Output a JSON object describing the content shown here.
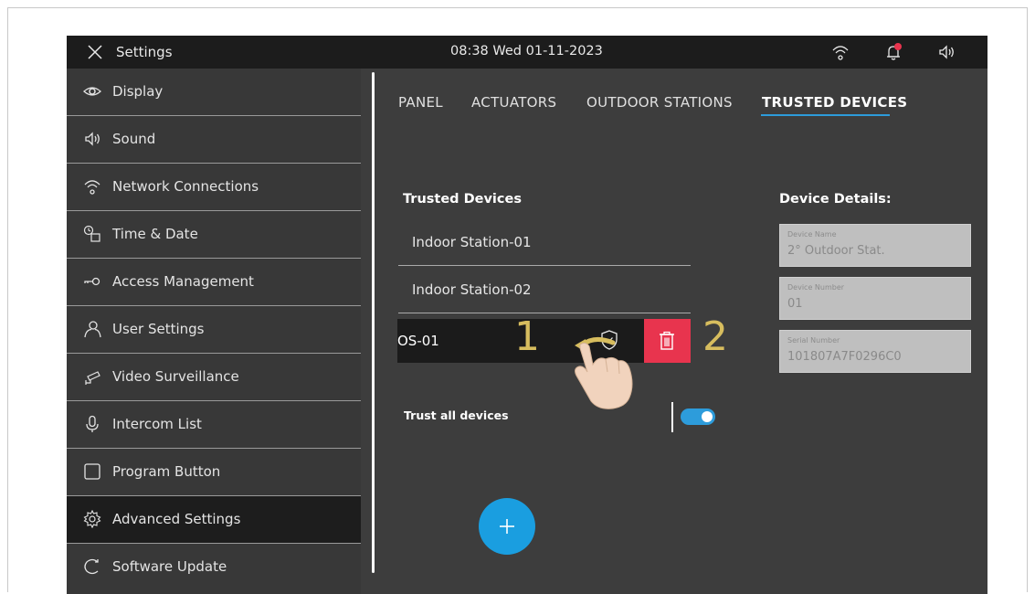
{
  "topbar": {
    "title": "Settings",
    "clock": "08:38  Wed 01-11-2023",
    "icons": [
      "close-icon",
      "wifi-icon",
      "bell-icon",
      "speaker-icon"
    ],
    "notification_dot_color": "#e8344e"
  },
  "sidebar": {
    "items": [
      {
        "label": "Display",
        "icon": "eye-icon"
      },
      {
        "label": "Sound",
        "icon": "speaker-icon"
      },
      {
        "label": "Network Connections",
        "icon": "wifi-icon"
      },
      {
        "label": "Time & Date",
        "icon": "clock-calendar-icon"
      },
      {
        "label": "Access Management",
        "icon": "key-icon"
      },
      {
        "label": "User Settings",
        "icon": "user-icon"
      },
      {
        "label": "Video Surveillance",
        "icon": "camera-icon"
      },
      {
        "label": "Intercom List",
        "icon": "microphone-icon"
      },
      {
        "label": "Program Button",
        "icon": "square-icon"
      },
      {
        "label": "Advanced Settings",
        "icon": "gear-icon",
        "active": true
      },
      {
        "label": "Software Update",
        "icon": "refresh-icon"
      }
    ]
  },
  "tabs": [
    {
      "label": "PANEL"
    },
    {
      "label": "ACTUATORS"
    },
    {
      "label": "OUTDOOR STATIONS"
    },
    {
      "label": "TRUSTED DEVICES",
      "active": true
    }
  ],
  "trusted": {
    "heading": "Trusted Devices",
    "devices": [
      "Indoor Station-01",
      "Indoor Station-02"
    ],
    "swiped_device": "OS-01",
    "step_1": "1",
    "step_2": "2",
    "trust_all_label": "Trust all devices",
    "trust_all_enabled": true
  },
  "details": {
    "heading": "Device Details:",
    "fields": [
      {
        "label": "Device Name",
        "value": "2° Outdoor Stat."
      },
      {
        "label": "Device Number",
        "value": "01"
      },
      {
        "label": "Serial Number",
        "value": "101807A7F0296C0"
      }
    ]
  },
  "colors": {
    "accent": "#2d9cdb",
    "delete": "#e8344e",
    "annotation": "#d7bd5e"
  }
}
